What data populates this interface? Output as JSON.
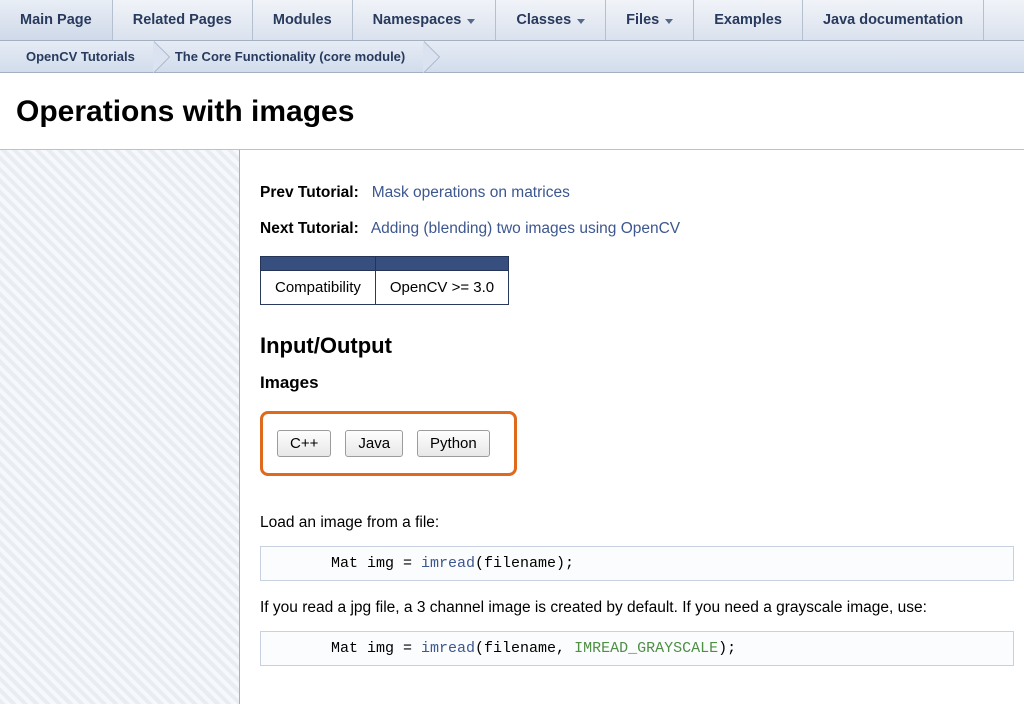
{
  "nav": {
    "items": [
      {
        "label": "Main Page",
        "dropdown": false
      },
      {
        "label": "Related Pages",
        "dropdown": false
      },
      {
        "label": "Modules",
        "dropdown": false
      },
      {
        "label": "Namespaces",
        "dropdown": true
      },
      {
        "label": "Classes",
        "dropdown": true
      },
      {
        "label": "Files",
        "dropdown": true
      },
      {
        "label": "Examples",
        "dropdown": false
      },
      {
        "label": "Java documentation",
        "dropdown": false
      }
    ]
  },
  "breadcrumb": {
    "items": [
      "OpenCV Tutorials",
      "The Core Functionality (core module)"
    ]
  },
  "page": {
    "title": "Operations with images",
    "prev_label": "Prev Tutorial:",
    "prev_link": "Mask operations on matrices",
    "next_label": "Next Tutorial:",
    "next_link": "Adding (blending) two images using OpenCV",
    "compat": {
      "col1": "Compatibility",
      "col2": "OpenCV >= 3.0"
    },
    "section_io": "Input/Output",
    "subsection_images": "Images",
    "lang_tabs": [
      "C++",
      "Java",
      "Python"
    ],
    "para_load": "Load an image from a file:",
    "code1": "Mat img = imread(filename);",
    "para_jpg": "If you read a jpg file, a 3 channel image is created by default. If you need a grayscale image, use:",
    "code2": "Mat img = imread(filename, IMREAD_GRAYSCALE);"
  }
}
